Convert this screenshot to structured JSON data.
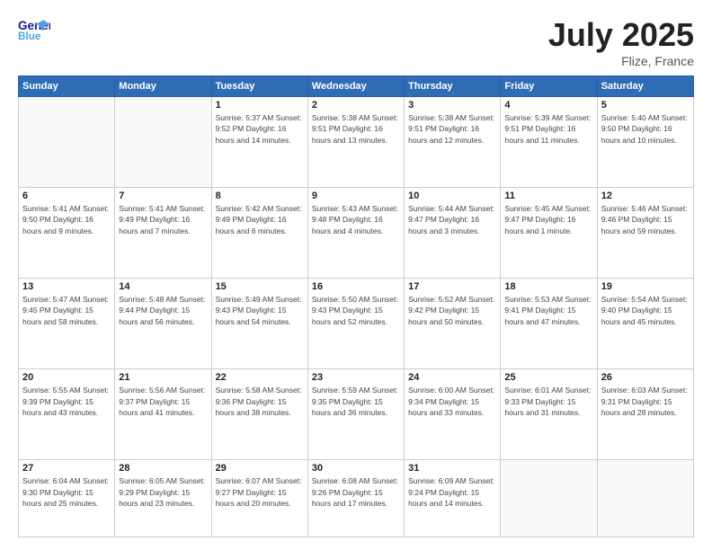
{
  "header": {
    "logo_line1": "General",
    "logo_line2": "Blue",
    "title": "July 2025",
    "location": "Flize, France"
  },
  "weekdays": [
    "Sunday",
    "Monday",
    "Tuesday",
    "Wednesday",
    "Thursday",
    "Friday",
    "Saturday"
  ],
  "weeks": [
    [
      {
        "day": "",
        "info": ""
      },
      {
        "day": "",
        "info": ""
      },
      {
        "day": "1",
        "info": "Sunrise: 5:37 AM\nSunset: 9:52 PM\nDaylight: 16 hours\nand 14 minutes."
      },
      {
        "day": "2",
        "info": "Sunrise: 5:38 AM\nSunset: 9:51 PM\nDaylight: 16 hours\nand 13 minutes."
      },
      {
        "day": "3",
        "info": "Sunrise: 5:38 AM\nSunset: 9:51 PM\nDaylight: 16 hours\nand 12 minutes."
      },
      {
        "day": "4",
        "info": "Sunrise: 5:39 AM\nSunset: 9:51 PM\nDaylight: 16 hours\nand 11 minutes."
      },
      {
        "day": "5",
        "info": "Sunrise: 5:40 AM\nSunset: 9:50 PM\nDaylight: 16 hours\nand 10 minutes."
      }
    ],
    [
      {
        "day": "6",
        "info": "Sunrise: 5:41 AM\nSunset: 9:50 PM\nDaylight: 16 hours\nand 9 minutes."
      },
      {
        "day": "7",
        "info": "Sunrise: 5:41 AM\nSunset: 9:49 PM\nDaylight: 16 hours\nand 7 minutes."
      },
      {
        "day": "8",
        "info": "Sunrise: 5:42 AM\nSunset: 9:49 PM\nDaylight: 16 hours\nand 6 minutes."
      },
      {
        "day": "9",
        "info": "Sunrise: 5:43 AM\nSunset: 9:48 PM\nDaylight: 16 hours\nand 4 minutes."
      },
      {
        "day": "10",
        "info": "Sunrise: 5:44 AM\nSunset: 9:47 PM\nDaylight: 16 hours\nand 3 minutes."
      },
      {
        "day": "11",
        "info": "Sunrise: 5:45 AM\nSunset: 9:47 PM\nDaylight: 16 hours\nand 1 minute."
      },
      {
        "day": "12",
        "info": "Sunrise: 5:46 AM\nSunset: 9:46 PM\nDaylight: 15 hours\nand 59 minutes."
      }
    ],
    [
      {
        "day": "13",
        "info": "Sunrise: 5:47 AM\nSunset: 9:45 PM\nDaylight: 15 hours\nand 58 minutes."
      },
      {
        "day": "14",
        "info": "Sunrise: 5:48 AM\nSunset: 9:44 PM\nDaylight: 15 hours\nand 56 minutes."
      },
      {
        "day": "15",
        "info": "Sunrise: 5:49 AM\nSunset: 9:43 PM\nDaylight: 15 hours\nand 54 minutes."
      },
      {
        "day": "16",
        "info": "Sunrise: 5:50 AM\nSunset: 9:43 PM\nDaylight: 15 hours\nand 52 minutes."
      },
      {
        "day": "17",
        "info": "Sunrise: 5:52 AM\nSunset: 9:42 PM\nDaylight: 15 hours\nand 50 minutes."
      },
      {
        "day": "18",
        "info": "Sunrise: 5:53 AM\nSunset: 9:41 PM\nDaylight: 15 hours\nand 47 minutes."
      },
      {
        "day": "19",
        "info": "Sunrise: 5:54 AM\nSunset: 9:40 PM\nDaylight: 15 hours\nand 45 minutes."
      }
    ],
    [
      {
        "day": "20",
        "info": "Sunrise: 5:55 AM\nSunset: 9:39 PM\nDaylight: 15 hours\nand 43 minutes."
      },
      {
        "day": "21",
        "info": "Sunrise: 5:56 AM\nSunset: 9:37 PM\nDaylight: 15 hours\nand 41 minutes."
      },
      {
        "day": "22",
        "info": "Sunrise: 5:58 AM\nSunset: 9:36 PM\nDaylight: 15 hours\nand 38 minutes."
      },
      {
        "day": "23",
        "info": "Sunrise: 5:59 AM\nSunset: 9:35 PM\nDaylight: 15 hours\nand 36 minutes."
      },
      {
        "day": "24",
        "info": "Sunrise: 6:00 AM\nSunset: 9:34 PM\nDaylight: 15 hours\nand 33 minutes."
      },
      {
        "day": "25",
        "info": "Sunrise: 6:01 AM\nSunset: 9:33 PM\nDaylight: 15 hours\nand 31 minutes."
      },
      {
        "day": "26",
        "info": "Sunrise: 6:03 AM\nSunset: 9:31 PM\nDaylight: 15 hours\nand 28 minutes."
      }
    ],
    [
      {
        "day": "27",
        "info": "Sunrise: 6:04 AM\nSunset: 9:30 PM\nDaylight: 15 hours\nand 25 minutes."
      },
      {
        "day": "28",
        "info": "Sunrise: 6:05 AM\nSunset: 9:29 PM\nDaylight: 15 hours\nand 23 minutes."
      },
      {
        "day": "29",
        "info": "Sunrise: 6:07 AM\nSunset: 9:27 PM\nDaylight: 15 hours\nand 20 minutes."
      },
      {
        "day": "30",
        "info": "Sunrise: 6:08 AM\nSunset: 9:26 PM\nDaylight: 15 hours\nand 17 minutes."
      },
      {
        "day": "31",
        "info": "Sunrise: 6:09 AM\nSunset: 9:24 PM\nDaylight: 15 hours\nand 14 minutes."
      },
      {
        "day": "",
        "info": ""
      },
      {
        "day": "",
        "info": ""
      }
    ]
  ]
}
